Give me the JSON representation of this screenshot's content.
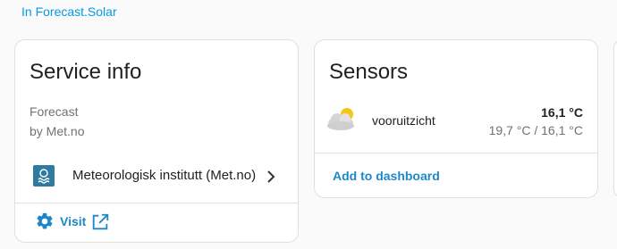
{
  "breadcrumb_link": "In Forecast.Solar",
  "service_card": {
    "title": "Service info",
    "line1": "Forecast",
    "line2": "by Met.no",
    "provider_label": "Meteorologisk institutt (Met.no)",
    "visit_label": "Visit"
  },
  "sensors_card": {
    "title": "Sensors",
    "sensor_name": "vooruitzicht",
    "sensor_temp": "16,1 °C",
    "sensor_range": "19,7 °C / 16,1 °C",
    "add_label": "Add to dashboard"
  },
  "icons": {
    "provider": "met-no-logo-icon",
    "chevron": "chevron-right-icon",
    "visit": "gear-icon",
    "external": "open-in-new-icon",
    "weather": "partly-cloudy-icon"
  },
  "colors": {
    "accent": "#1e88c7",
    "logo": "#2f7aa0",
    "border": "#e0e0e0",
    "background": "#fafafa"
  }
}
